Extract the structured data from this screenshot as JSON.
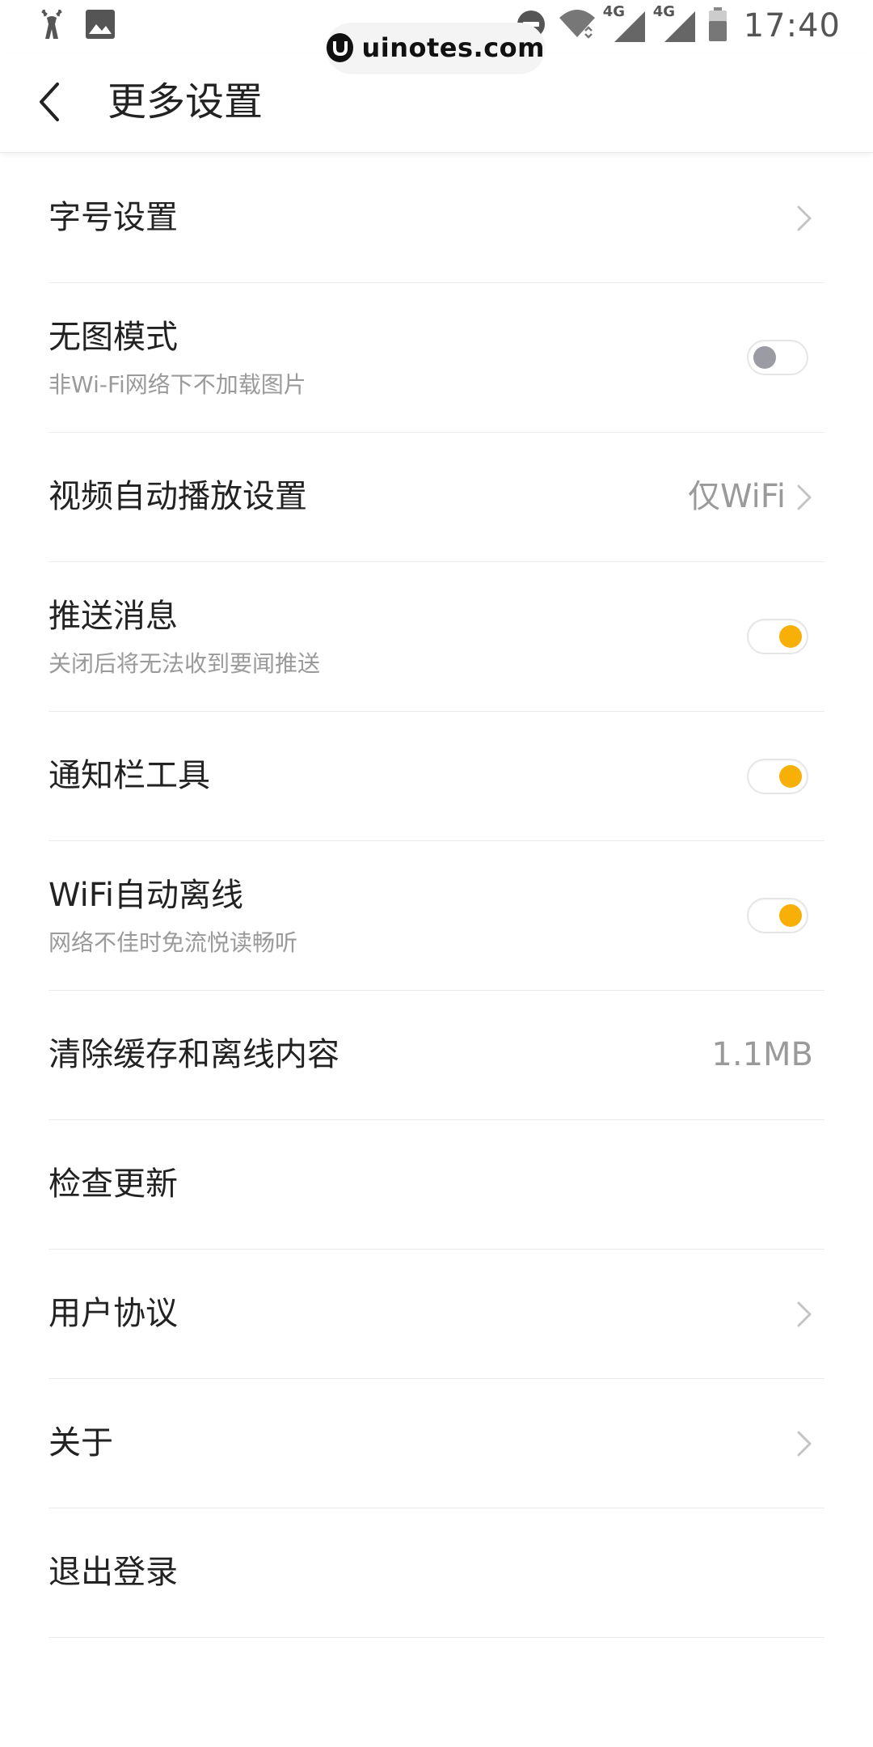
{
  "status_bar": {
    "time": "17:40",
    "network_labels": [
      "4G",
      "4G"
    ],
    "icons": [
      "deer-icon",
      "image-icon",
      "do-not-disturb-icon",
      "wifi-icon",
      "signal-icon",
      "signal-icon",
      "battery-icon"
    ]
  },
  "watermark": {
    "text": "uinotes.com"
  },
  "header": {
    "title": "更多设置"
  },
  "settings": {
    "font_size": {
      "title": "字号设置"
    },
    "no_image_mode": {
      "title": "无图模式",
      "subtitle": "非Wi-Fi网络下不加载图片",
      "enabled": false
    },
    "video_autoplay": {
      "title": "视频自动播放设置",
      "value": "仅WiFi"
    },
    "push_messages": {
      "title": "推送消息",
      "subtitle": "关闭后将无法收到要闻推送",
      "enabled": true
    },
    "notification_tool": {
      "title": "通知栏工具",
      "enabled": true
    },
    "wifi_offline": {
      "title": "WiFi自动离线",
      "subtitle": "网络不佳时免流悦读畅听",
      "enabled": true
    },
    "clear_cache": {
      "title": "清除缓存和离线内容",
      "value": "1.1MB"
    },
    "check_update": {
      "title": "检查更新"
    },
    "user_agreement": {
      "title": "用户协议"
    },
    "about": {
      "title": "关于"
    },
    "logout": {
      "title": "退出登录"
    }
  },
  "colors": {
    "accent": "#f8b008",
    "toggle_off_knob": "#9b9ba3",
    "secondary_text": "#9a9a9a",
    "divider": "#ebebeb"
  }
}
